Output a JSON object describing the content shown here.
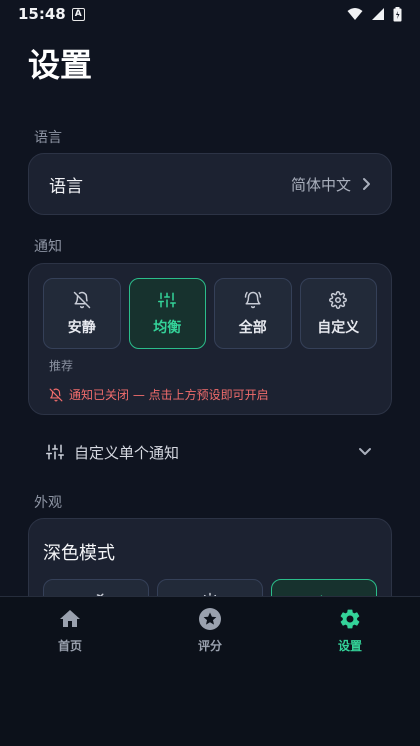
{
  "status_bar": {
    "time": "15:48",
    "badge": "A"
  },
  "page": {
    "title": "设置"
  },
  "language_section": {
    "label": "语言",
    "row_label": "语言",
    "row_value": "简体中文"
  },
  "notification_section": {
    "label": "通知",
    "options": [
      {
        "label": "安静",
        "icon": "bell-off-icon"
      },
      {
        "label": "均衡",
        "icon": "sliders-icon"
      },
      {
        "label": "全部",
        "icon": "bell-ring-icon"
      },
      {
        "label": "自定义",
        "icon": "gear-icon"
      }
    ],
    "selected": "均衡",
    "recommended_label": "推荐",
    "warning": "通知已关闭 — 点击上方预设即可开启",
    "custom_label": "自定义单个通知"
  },
  "appearance_section": {
    "label": "外观",
    "dark_mode_title": "深色模式",
    "modes": [
      "auto-icon",
      "sun-icon",
      "moon-icon"
    ],
    "selected_mode": "moon-icon"
  },
  "bottom_nav": {
    "items": [
      {
        "label": "首页",
        "icon": "home-icon"
      },
      {
        "label": "评分",
        "icon": "star-icon"
      },
      {
        "label": "设置",
        "icon": "gear-icon"
      }
    ],
    "active": "设置"
  },
  "colors": {
    "background": "#0f1420",
    "card": "#1c2231",
    "accent": "#34d399",
    "warning": "#f06c6c"
  }
}
